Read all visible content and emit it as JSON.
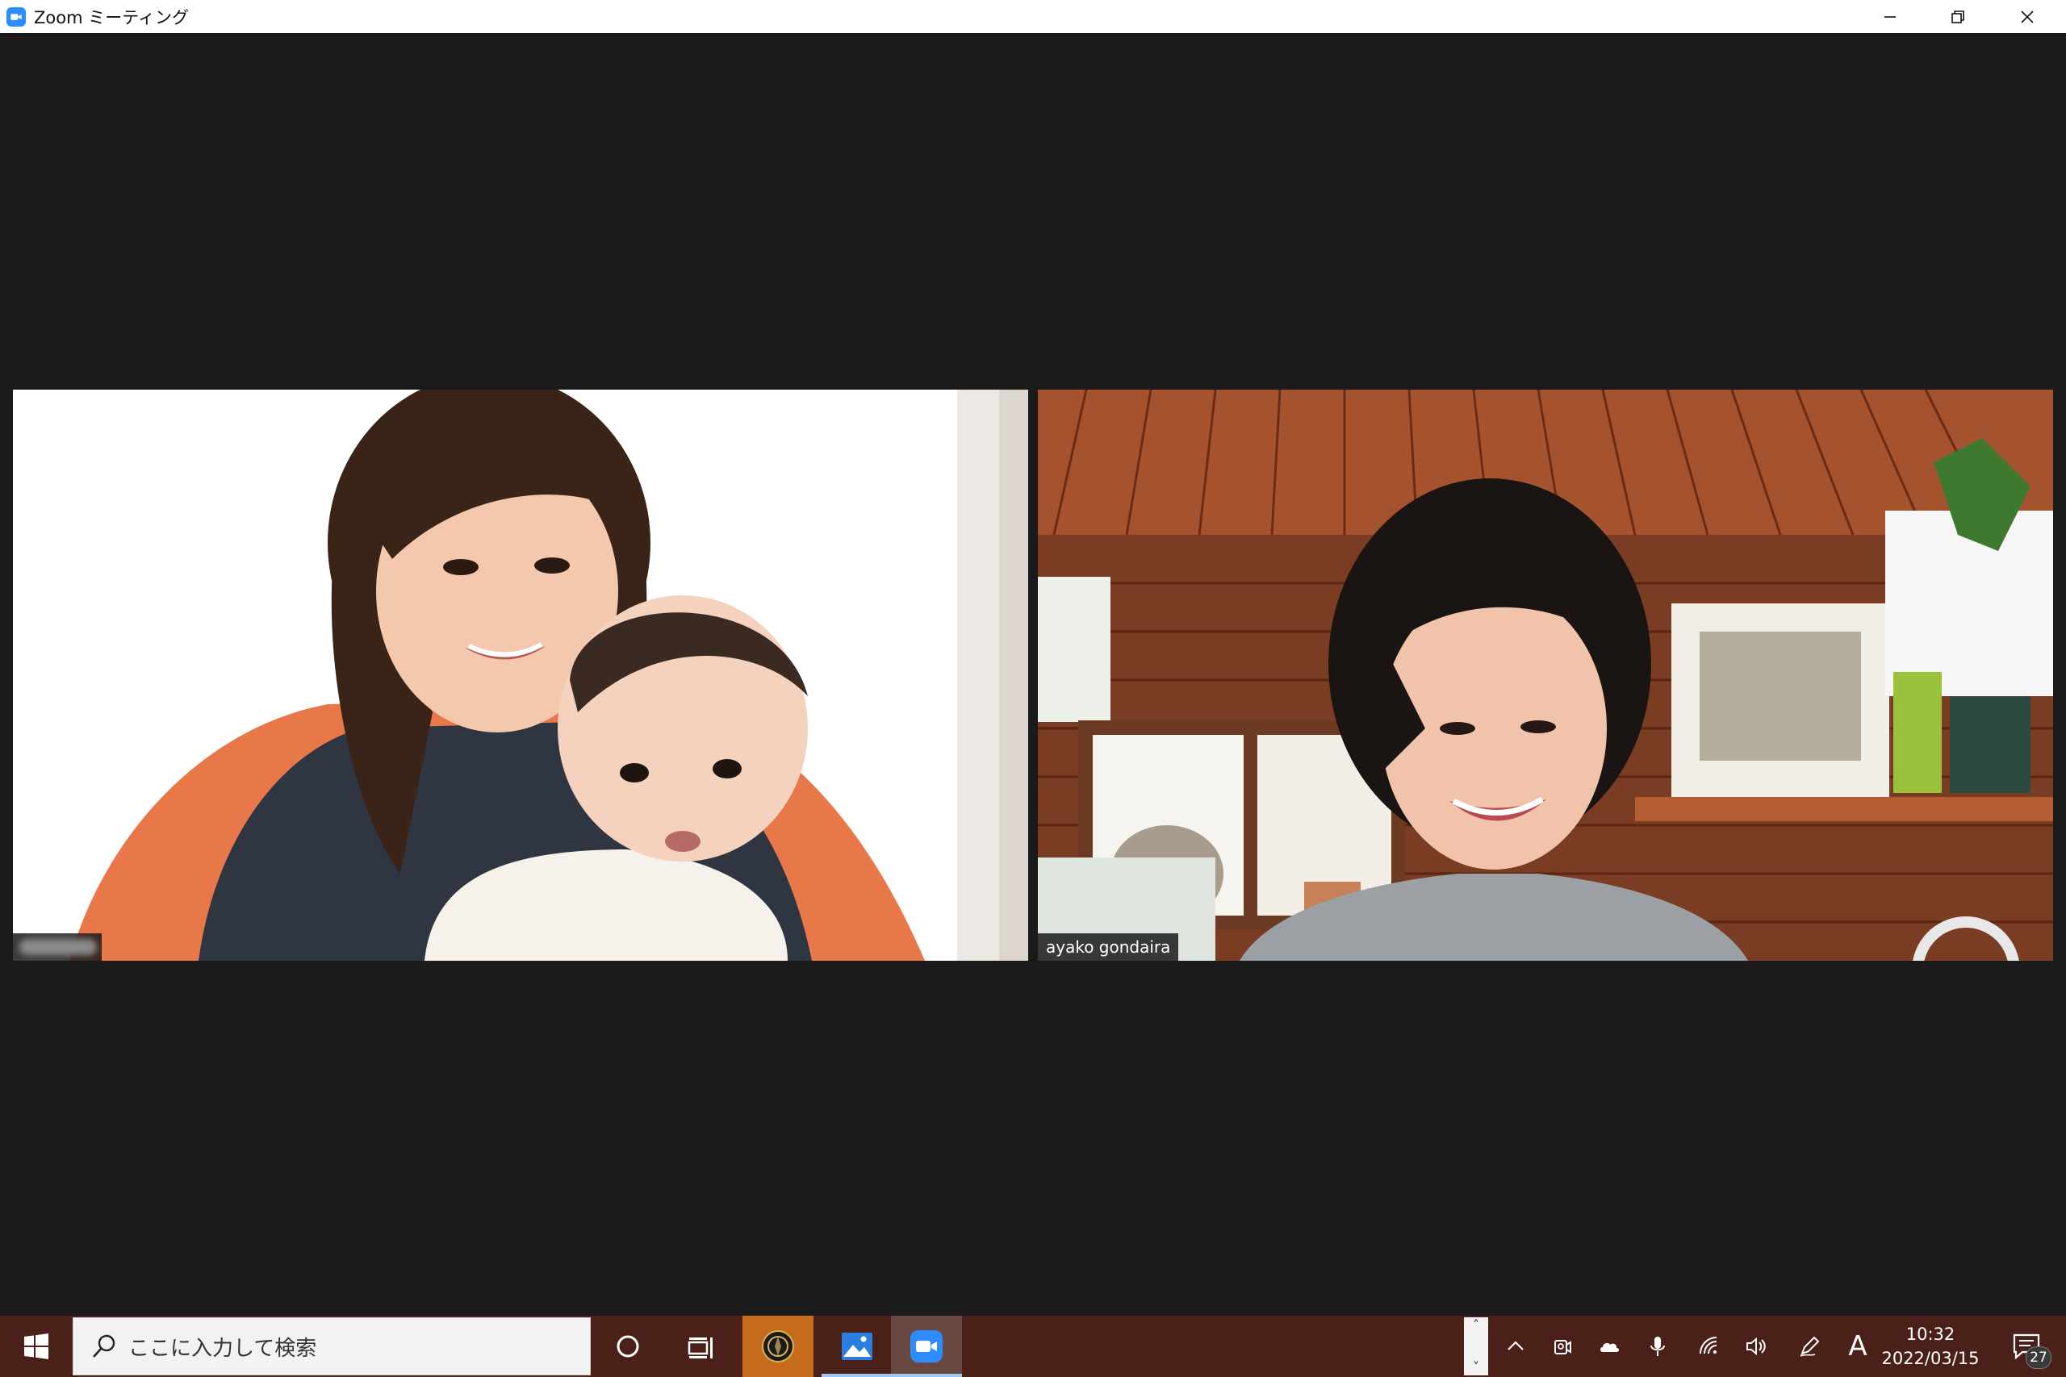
{
  "window": {
    "title": "Zoom ミーティング",
    "icon": "zoom-camera-icon",
    "controls": [
      "minimize-icon",
      "restore-icon",
      "close-icon"
    ]
  },
  "meeting": {
    "layout": "gallery",
    "participants": [
      {
        "name": "",
        "name_hidden": true
      },
      {
        "name": "ayako gondaira",
        "name_hidden": false
      }
    ]
  },
  "taskbar": {
    "start_icon": "windows-start-icon",
    "search": {
      "placeholder": "ここに入力して検索",
      "icon": "search-icon"
    },
    "pinned": [
      {
        "name": "capture-app",
        "icon": "aperture-icon",
        "active": false
      },
      {
        "name": "photos",
        "icon": "photos-icon",
        "active": false
      },
      {
        "name": "zoom",
        "icon": "zoom-camera-icon",
        "active": true
      }
    ],
    "tray": {
      "icons": [
        "chevron-up-icon",
        "meet-now-icon",
        "onedrive-cloud-icon",
        "microphone-icon",
        "wifi-icon",
        "speaker-icon",
        "pen-icon"
      ],
      "ime": "A",
      "time": "10:32",
      "date": "2022/03/15",
      "notifications": "27"
    }
  },
  "colors": {
    "meeting_bg": "#1a1a1a",
    "taskbar_bg": "#4a2019",
    "zoom_blue": "#2d8cff"
  }
}
